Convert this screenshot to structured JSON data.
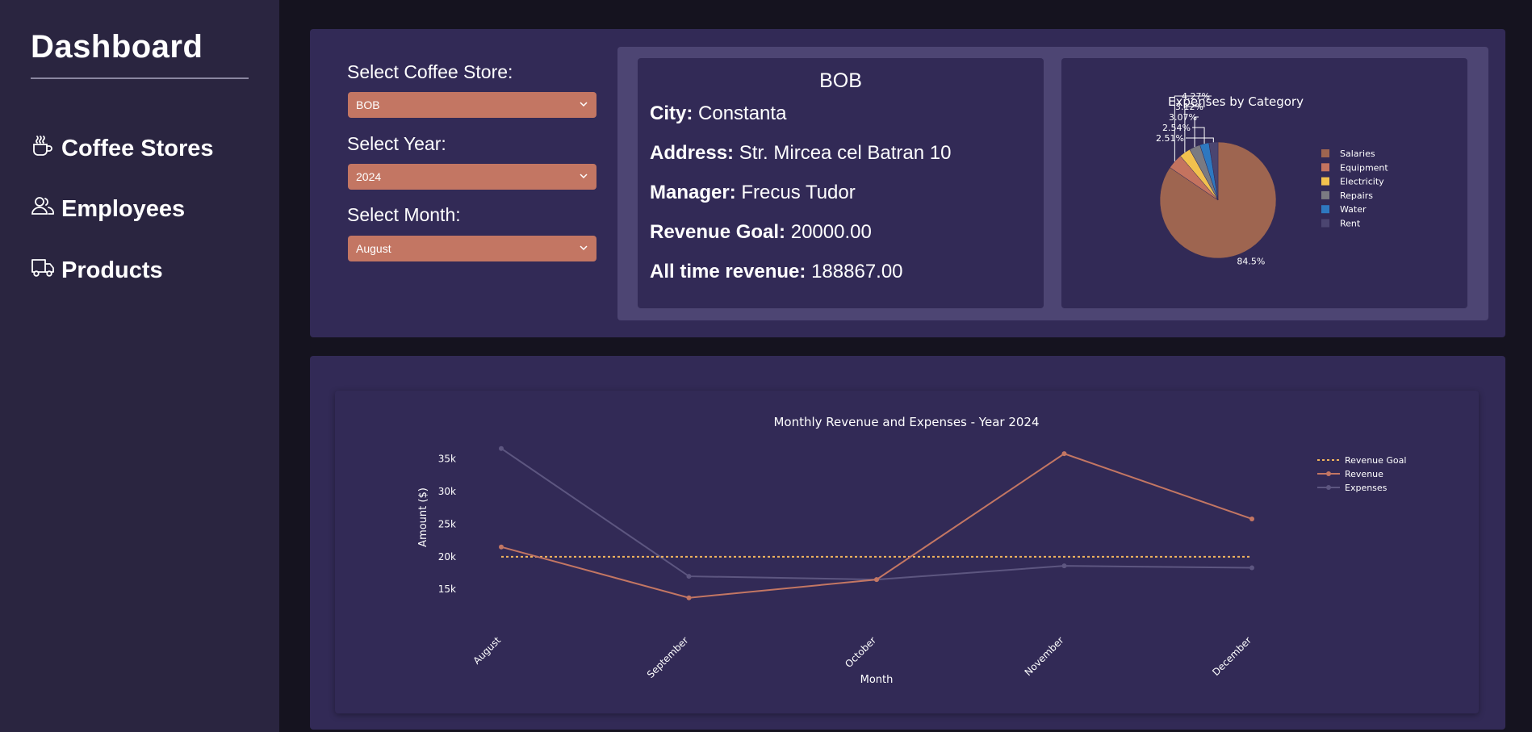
{
  "sidebar": {
    "title": "Dashboard",
    "items": [
      {
        "label": "Coffee Stores",
        "icon": "coffee-icon"
      },
      {
        "label": "Employees",
        "icon": "users-icon"
      },
      {
        "label": "Products",
        "icon": "truck-icon"
      }
    ]
  },
  "filters": {
    "store_label": "Select Coffee Store:",
    "store_value": "BOB",
    "year_label": "Select Year:",
    "year_value": "2024",
    "month_label": "Select Month:",
    "month_value": "August"
  },
  "store": {
    "name": "BOB",
    "city_label": "City:",
    "city": "Constanta",
    "address_label": "Address:",
    "address": "Str. Mircea cel Batran 10",
    "manager_label": "Manager:",
    "manager": "Frecus Tudor",
    "goal_label": "Revenue Goal:",
    "goal": "20000.00",
    "alltime_label": "All time revenue:",
    "alltime": "188867.00"
  },
  "colors": {
    "accent": "#c37663",
    "panel": "#322a56",
    "sidebar": "#2a2540",
    "background": "#15131f"
  },
  "chart_data": [
    {
      "type": "pie",
      "title": "Expenses by Category",
      "labels": [
        "Salaries",
        "Equipment",
        "Electricity",
        "Repairs",
        "Water",
        "Rent"
      ],
      "values": [
        84.5,
        4.27,
        3.12,
        3.07,
        2.54,
        2.51
      ],
      "value_labels": [
        "84.5%",
        "4.27%",
        "3.12%",
        "3.07%",
        "2.54%",
        "2.51%"
      ],
      "colors": [
        "#9e6550",
        "#c4735f",
        "#f2c14e",
        "#7a7a82",
        "#2e78c0",
        "#4b4570"
      ],
      "legend_position": "right"
    },
    {
      "type": "line",
      "title": "Monthly Revenue and Expenses - Year 2024",
      "xlabel": "Month",
      "ylabel": "Amount ($)",
      "categories": [
        "August",
        "September",
        "October",
        "November",
        "December"
      ],
      "yticks": [
        15000,
        20000,
        25000,
        30000,
        35000
      ],
      "ytick_labels": [
        "15k",
        "20k",
        "25k",
        "30k",
        "35k"
      ],
      "ylim": [
        12800,
        37800
      ],
      "series": [
        {
          "name": "Revenue Goal",
          "values": [
            20000,
            20000,
            20000,
            20000,
            20000
          ],
          "color": "#f2b55e",
          "style": "dotted"
        },
        {
          "name": "Revenue",
          "values": [
            21500,
            13700,
            16500,
            35800,
            25800
          ],
          "color": "#c37663",
          "style": "solid"
        },
        {
          "name": "Expenses",
          "values": [
            36600,
            17000,
            16500,
            18600,
            18300
          ],
          "color": "#5d5680",
          "style": "solid"
        }
      ],
      "legend_position": "top-right",
      "grid": false
    }
  ]
}
